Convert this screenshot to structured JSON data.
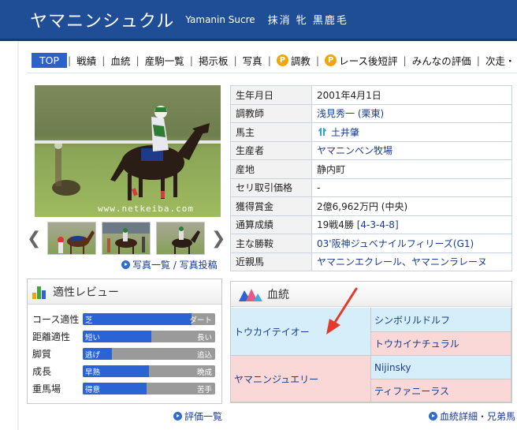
{
  "header": {
    "name": "ヤマニンシュクル",
    "roman": "Yamanin Sucre",
    "meta": "抹消 牝 黒鹿毛"
  },
  "nav": {
    "items": [
      {
        "label": "TOP",
        "active": true
      },
      {
        "label": "戦績"
      },
      {
        "label": "血統"
      },
      {
        "label": "産駒一覧"
      },
      {
        "label": "掲示板"
      },
      {
        "label": "写真"
      },
      {
        "label": "調教",
        "badge": "P"
      },
      {
        "label": "レース後短評",
        "badge": "P"
      },
      {
        "label": "みんなの評価"
      },
      {
        "label": "次走・"
      }
    ]
  },
  "photo": {
    "watermark": "www.netkeiba.com",
    "links": "写真一覧 / 写真投稿"
  },
  "profile": [
    {
      "key": "生年月日",
      "value": "2001年4月1日"
    },
    {
      "key": "調教師",
      "value": "浅見秀一 (栗東)",
      "link": true
    },
    {
      "key": "馬主",
      "value": "土井肇",
      "link": true,
      "owner_icon": "silks-icon"
    },
    {
      "key": "生産者",
      "value": "ヤマニンベン牧場",
      "link": true
    },
    {
      "key": "産地",
      "value": "静内町"
    },
    {
      "key": "セリ取引価格",
      "value": "-"
    },
    {
      "key": "獲得賞金",
      "value": "2億6,962万円 (中央)"
    },
    {
      "key": "通算成績",
      "value": "19戦4勝 [4-3-4-8]"
    },
    {
      "key": "主な勝鞍",
      "value": "03'阪神ジュベナイルフィリーズ(G1)",
      "link": true
    },
    {
      "key": "近親馬",
      "value": "ヤマニンエクレール、ヤマニンラレーヌ",
      "link": true
    }
  ],
  "aptitude": {
    "title": "適性レビュー",
    "rows": [
      {
        "label": "コース適性",
        "left": "芝",
        "right": "ダート",
        "level": 0.82
      },
      {
        "label": "距離適性",
        "left": "短い",
        "right": "長い",
        "level": 0.52
      },
      {
        "label": "脚質",
        "left": "逃げ",
        "right": "追込",
        "level": 0.22
      },
      {
        "label": "成長",
        "left": "早熟",
        "right": "晩成",
        "level": 0.5
      },
      {
        "label": "重馬場",
        "left": "得意",
        "right": "苦手",
        "level": 0.48
      }
    ],
    "link": "評価一覧"
  },
  "pedigree": {
    "title": "血統",
    "sire": "トウカイテイオー",
    "sire_sire": "シンボリルドルフ",
    "sire_dam": "トウカイナチュラル",
    "dam": "ヤマニンジュエリー",
    "dam_sire": "Nijinsky",
    "dam_dam": "ティファニーラス",
    "link": "血統詳細・兄弟馬"
  },
  "colors": {
    "header": "#1f4e96",
    "accent": "#2b61c9",
    "link": "#1a3c8c",
    "male": "#d5eefa",
    "female": "#fbd8d8",
    "annotation": "#e5392c"
  }
}
